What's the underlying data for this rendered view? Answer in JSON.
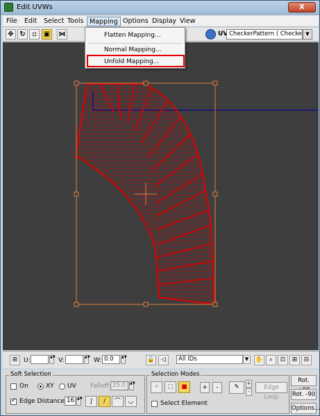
{
  "window": {
    "title": "Edit UVWs",
    "close_label": "X"
  },
  "menubar": {
    "items": [
      "File",
      "Edit",
      "Select",
      "Tools",
      "Mapping",
      "Options",
      "Display",
      "View"
    ]
  },
  "mapping_menu": {
    "items": [
      "Flatten Mapping...",
      "Normal Mapping...",
      "Unfold Mapping..."
    ],
    "highlighted_item": "Unfold Mapping..."
  },
  "toolbar": {
    "uv_label": "UV",
    "texture_select": "CheckerPattern  ( Checker )"
  },
  "statusbar": {
    "u_label": "U:",
    "v_label": "V:",
    "w_label": "W:",
    "u_value": "",
    "v_value": "",
    "w_value": "0.0",
    "ids_select": "All IDs"
  },
  "soft_selection": {
    "title": "Soft Selection",
    "on_label": "On",
    "xy_label": "XY",
    "uv_label": "UV",
    "falloff_label": "Falloff:",
    "falloff_value": "25.0",
    "edge_distance_label": "Edge Distance",
    "edge_distance_checked": true,
    "edge_distance_value": "16"
  },
  "selection_modes": {
    "title": "Selection Modes",
    "plus_label": "+",
    "minus_label": "-",
    "edge_loop_label": "Edge Loop",
    "select_element_label": "Select Element"
  },
  "rotate": {
    "rot_plus_label": "Rot. +90",
    "rot_minus_label": "Rot. -90",
    "options_label": "Options..."
  },
  "colors": {
    "mesh": "#e00000",
    "viewport_bg": "#3e3e3e",
    "gizmo": "#e08040",
    "frame_line": "#1a1a70",
    "highlight_box": "#e60000"
  }
}
